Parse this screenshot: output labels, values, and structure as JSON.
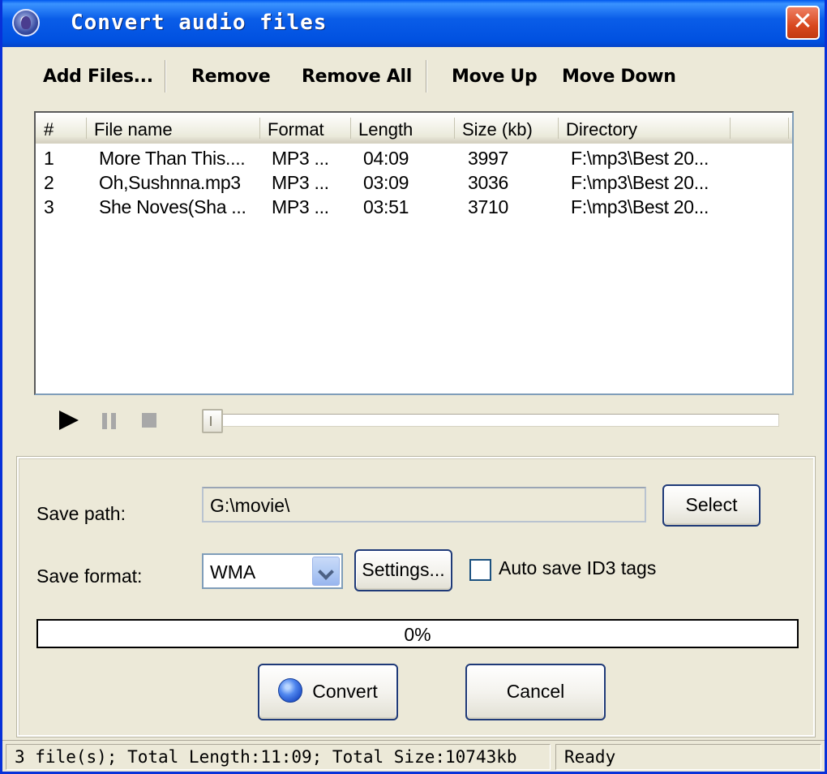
{
  "window": {
    "title": "Convert audio files",
    "close_label": "✕"
  },
  "toolbar": {
    "add_files": "Add Files...",
    "remove": "Remove",
    "remove_all": "Remove All",
    "move_up": "Move Up",
    "move_down": "Move Down"
  },
  "file_list": {
    "columns": [
      "#",
      "File name",
      "Format",
      "Length",
      "Size (kb)",
      "Directory"
    ],
    "rows": [
      {
        "num": "1",
        "name": "More Than This....",
        "format": "MP3 ...",
        "length": "04:09",
        "size": "3997",
        "dir": "F:\\mp3\\Best 20..."
      },
      {
        "num": "2",
        "name": "Oh,Sushnna.mp3",
        "format": "MP3 ...",
        "length": "03:09",
        "size": "3036",
        "dir": "F:\\mp3\\Best 20..."
      },
      {
        "num": "3",
        "name": "She Noves(Sha ...",
        "format": "MP3 ...",
        "length": "03:51",
        "size": "3710",
        "dir": "F:\\mp3\\Best 20..."
      }
    ]
  },
  "player": {
    "position_fraction": 0
  },
  "options": {
    "save_path_label": "Save path:",
    "save_path_value": "G:\\movie\\",
    "select_button": "Select",
    "save_format_label": "Save format:",
    "save_format_value": "WMA",
    "settings_button": "Settings...",
    "id3_label": "Auto save ID3 tags",
    "id3_checked": false
  },
  "progress": {
    "value_percent": 0,
    "text": "0%"
  },
  "actions": {
    "convert": "Convert",
    "cancel": "Cancel"
  },
  "status": {
    "summary": "3 file(s); Total Length:11:09; Total Size:10743kb",
    "state": "Ready"
  },
  "colors": {
    "title_bar": "#0a5de8",
    "window_bg": "#ece9d8",
    "close_button": "#d8481f"
  }
}
